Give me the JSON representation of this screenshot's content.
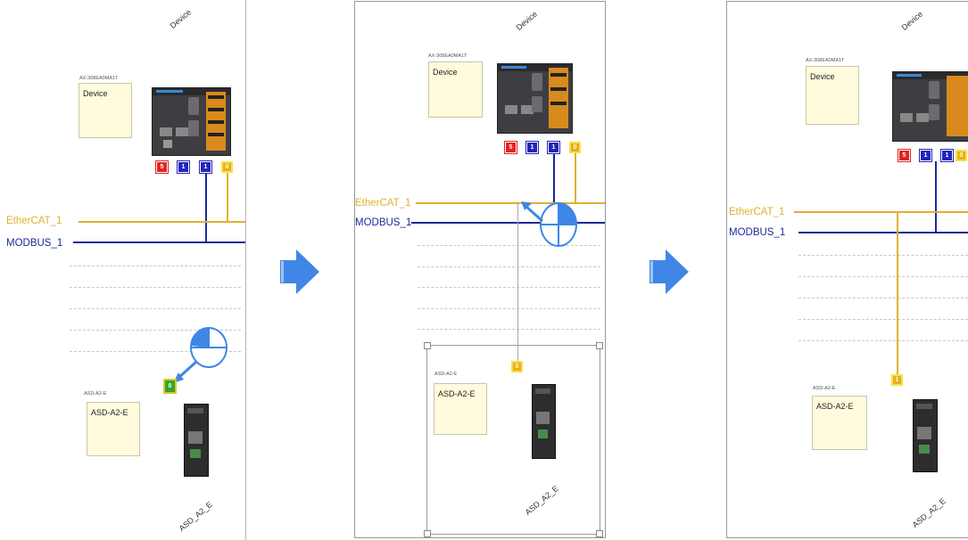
{
  "panels": [
    {
      "device_name": "Device",
      "plc_model": "AX-308EA0MA1T",
      "plc_note": "Device",
      "ports": [
        "5",
        "1",
        "1",
        "0"
      ],
      "buses": {
        "ethercat": "EtherCAT_1",
        "modbus": "MODBUS_1"
      },
      "servo_model": "ASD-A2-E",
      "servo_note": "ASD-A2-E",
      "servo_name": "ASD_A2_E",
      "servo_port": "0"
    },
    {
      "device_name": "Device",
      "plc_model": "AX-308EA0MA1T",
      "plc_note": "Device",
      "ports": [
        "5",
        "1",
        "1",
        "0"
      ],
      "buses": {
        "ethercat": "EtherCAT_1",
        "modbus": "MODBUS_1"
      },
      "servo_model": "ASD-A2-E",
      "servo_note": "ASD-A2-E",
      "servo_name": "ASD_A2_E",
      "servo_port": "0"
    },
    {
      "device_name": "Device",
      "plc_model": "AX-308EA0MA1T",
      "plc_note": "Device",
      "ports": [
        "5",
        "1",
        "1",
        "0"
      ],
      "buses": {
        "ethercat": "EtherCAT_1",
        "modbus": "MODBUS_1"
      },
      "servo_model": "ASD-A2-E",
      "servo_note": "ASD-A2-E",
      "servo_name": "ASD_A2_E",
      "servo_port": "1"
    }
  ],
  "colors": {
    "ethercat": "#e0b030",
    "modbus": "#1a2a9c",
    "step_arrow": "#3f86e6",
    "port_red": "#e22424",
    "port_blue": "#2325b8",
    "port_yellow": "#e8b015",
    "note_bg": "#fffbdc"
  },
  "icons": [
    "step-arrow-icon",
    "mouse-cursor-icon",
    "drag-arrow-icon"
  ]
}
